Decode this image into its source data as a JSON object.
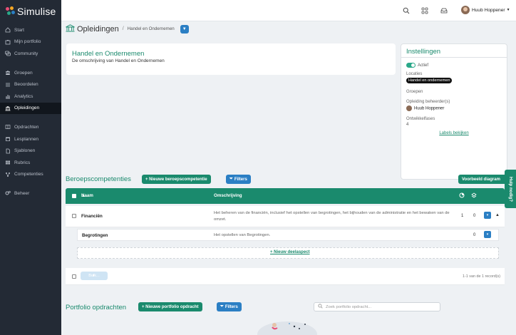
{
  "app": {
    "name": "Simulise"
  },
  "sidebar": {
    "items": [
      {
        "label": "Start",
        "icon": "home-icon"
      },
      {
        "label": "Mijn portfolio",
        "icon": "portfolio-icon"
      },
      {
        "label": "Community",
        "icon": "community-icon"
      },
      {
        "label": "Groepen",
        "icon": "groups-icon"
      },
      {
        "label": "Beoordelen",
        "icon": "list-icon"
      },
      {
        "label": "Analytics",
        "icon": "analytics-icon"
      },
      {
        "label": "Opleidingen",
        "icon": "education-icon",
        "active": true
      },
      {
        "label": "Opdrachten",
        "icon": "book-icon"
      },
      {
        "label": "Lesplannen",
        "icon": "calendar-icon"
      },
      {
        "label": "Sjablonen",
        "icon": "file-icon"
      },
      {
        "label": "Rubrics",
        "icon": "grid-icon"
      },
      {
        "label": "Competenties",
        "icon": "competence-icon"
      },
      {
        "label": "Beheer",
        "icon": "cogs-icon"
      }
    ]
  },
  "topbar": {
    "user_name": "Huub Hoppener"
  },
  "breadcrumb": {
    "title": "Opleidingen",
    "current": "Handel en Ondernemen"
  },
  "description": {
    "title": "Handel en Ondernemen",
    "text": "De omschrijving van Handel en Ondernemen"
  },
  "settings": {
    "title": "Instellingen",
    "active_label": "Actief",
    "locations_label": "Locaties",
    "location_value": "Handel en ondernemen",
    "groups_label": "Groepen",
    "managers_label": "Opleiding beheerder(s)",
    "manager_name": "Huub Hoppener",
    "phases_label": "Ontwikkelfases",
    "phases_value": "4",
    "labels_link": "Labels bekijken"
  },
  "competences": {
    "title": "Beroepscompetenties",
    "new_button": "+ Nieuwe beroepscompetentie",
    "filters_button": "Filters",
    "example_button": "Voorbeeld diagram",
    "help_tab": "Hulp nodig?",
    "columns": {
      "name": "Naam",
      "description": "Omschrijving"
    },
    "rows": [
      {
        "name": "Financiën",
        "description": "Het beheren van de financiën, inclusief het opstellen van begrotingen, het bijhouden van de administratie en het bewaken van de omzet.",
        "count_a": "1",
        "count_b": "0"
      }
    ],
    "subrows": [
      {
        "name": "Begrotingen",
        "description": "Het opstellen van Begrotingen.",
        "count": "0"
      }
    ],
    "add_subaspect": "+ Nieuw deelaspect",
    "bulk_button": "Bulk...",
    "record_count": "1-1 van de 1 record(s)"
  },
  "portfolio": {
    "title": "Portfolio opdrachten",
    "new_button": "+ Nieuwe portfolio opdracht",
    "filters_button": "Filters",
    "search_placeholder": "Zoek portfolio opdracht..."
  }
}
